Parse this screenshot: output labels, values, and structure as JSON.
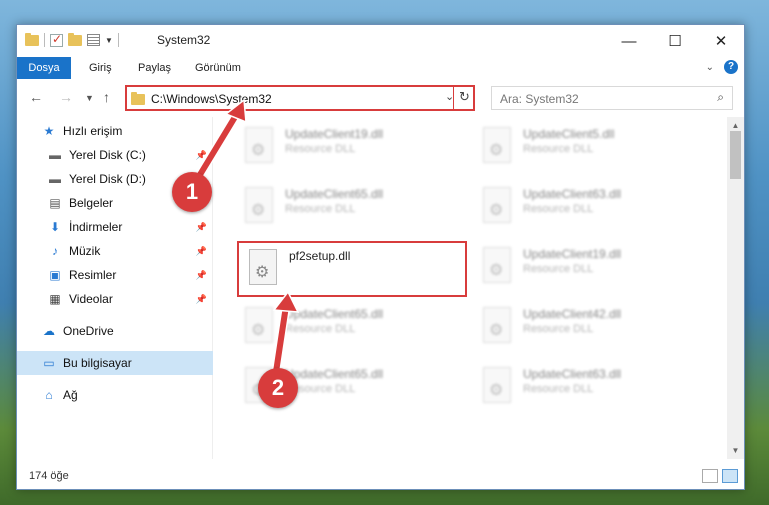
{
  "window": {
    "title": "System32",
    "controls": {
      "minimize": "—",
      "maximize": "☐",
      "close": "✕"
    }
  },
  "ribbon": {
    "tabs": [
      "Dosya",
      "Giriş",
      "Paylaş",
      "Görünüm"
    ]
  },
  "address": {
    "path": "C:\\Windows\\System32",
    "search_placeholder": "Ara: System32"
  },
  "nav": {
    "items": [
      {
        "label": "Hızlı erişim",
        "icon": "star-icon"
      },
      {
        "label": "Yerel Disk (C:)",
        "icon": "drive-icon"
      },
      {
        "label": "Yerel Disk (D:)",
        "icon": "drive-icon"
      },
      {
        "label": "Belgeler",
        "icon": "document-icon"
      },
      {
        "label": "İndirmeler",
        "icon": "download-icon"
      },
      {
        "label": "Müzik",
        "icon": "music-icon"
      },
      {
        "label": "Resimler",
        "icon": "pictures-icon"
      },
      {
        "label": "Videolar",
        "icon": "video-icon"
      },
      {
        "label": "OneDrive",
        "icon": "cloud-icon"
      },
      {
        "label": "Bu bilgisayar",
        "icon": "computer-icon"
      },
      {
        "label": "Ağ",
        "icon": "network-icon"
      }
    ]
  },
  "files": [
    {
      "name": "UpdateClient19.dll",
      "type": "Resource DLL"
    },
    {
      "name": "UpdateClient5.dll",
      "type": "Resource DLL"
    },
    {
      "name": "UpdateClient65.dll",
      "type": "Resource DLL"
    },
    {
      "name": "UpdateClient63.dll",
      "type": "Resource DLL"
    },
    {
      "name": "pf2setup.dll",
      "type": ""
    },
    {
      "name": "UpdateClient19.dll",
      "type": "Resource DLL"
    },
    {
      "name": "UpdateClient65.dll",
      "type": "Resource DLL"
    },
    {
      "name": "UpdateClient42.dll",
      "type": "Resource DLL"
    },
    {
      "name": "UpdateClient65.dll",
      "type": "Resource DLL"
    },
    {
      "name": "UpdateClient63.dll",
      "type": "Resource DLL"
    }
  ],
  "status": {
    "count": "174 öğe"
  },
  "annotations": {
    "step1": "1",
    "step2": "2"
  },
  "colors": {
    "accent": "#1a73c9",
    "highlight": "#d83c3c",
    "selected": "#cce4f7"
  }
}
